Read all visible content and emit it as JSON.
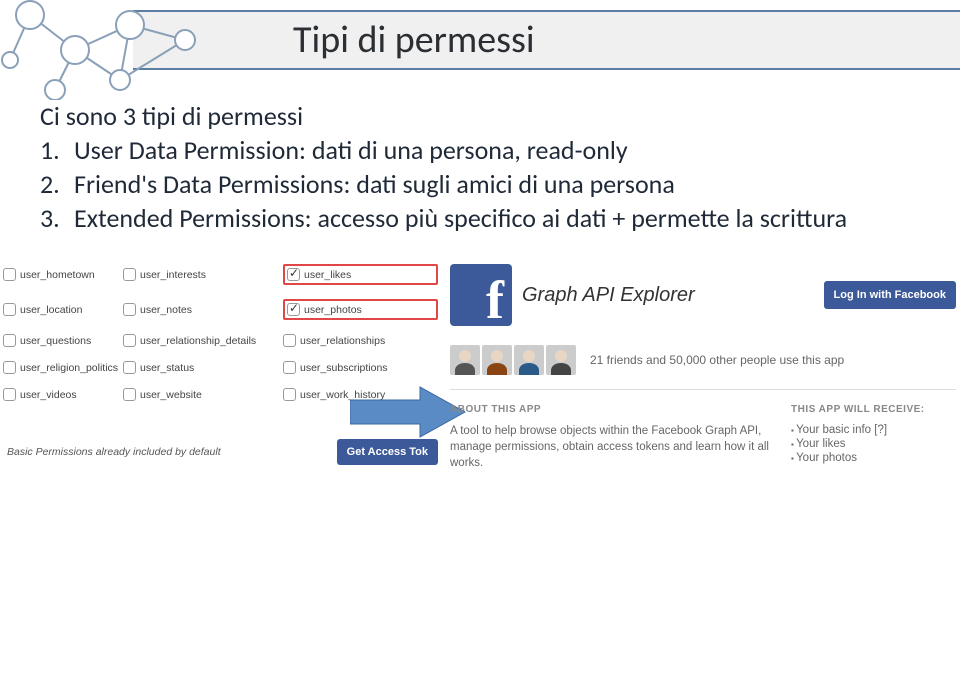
{
  "header": {
    "title": "Tipi di permessi"
  },
  "body": {
    "intro": "Ci sono 3 tipi di permessi",
    "items": [
      {
        "num": "1.",
        "text": "User Data Permission: dati di una persona, read-only"
      },
      {
        "num": "2.",
        "text": "Friend's Data Permissions: dati sugli amici di una persona"
      },
      {
        "num": "3.",
        "text": "Extended Permissions: accesso più specifico ai dati + permette la scrittura"
      }
    ]
  },
  "perm_panel": {
    "rows": [
      [
        "user_hometown",
        "user_interests",
        "user_likes"
      ],
      [
        "user_location",
        "user_notes",
        "user_photos"
      ],
      [
        "user_questions",
        "user_relationship_details",
        "user_relationships"
      ],
      [
        "user_religion_politics",
        "user_status",
        "user_subscriptions"
      ],
      [
        "user_videos",
        "user_website",
        "user_work_history"
      ]
    ],
    "checked": [
      "user_likes",
      "user_photos"
    ],
    "highlight": [
      "user_likes",
      "user_photos"
    ],
    "footer_note": "Basic Permissions already included by default",
    "token_btn": "Get Access Tok"
  },
  "fb_panel": {
    "app_title": "Graph API Explorer",
    "login_btn": "Log In with Facebook",
    "friends_text": "21 friends and 50,000 other people use this app",
    "about_heading": "ABOUT THIS APP",
    "about_text": "A tool to help browse objects within the Facebook Graph API, manage permissions, obtain access tokens and learn how it all works.",
    "receive_heading": "THIS APP WILL RECEIVE:",
    "receive_items": [
      "Your basic info [?]",
      "Your likes",
      "Your photos"
    ]
  }
}
